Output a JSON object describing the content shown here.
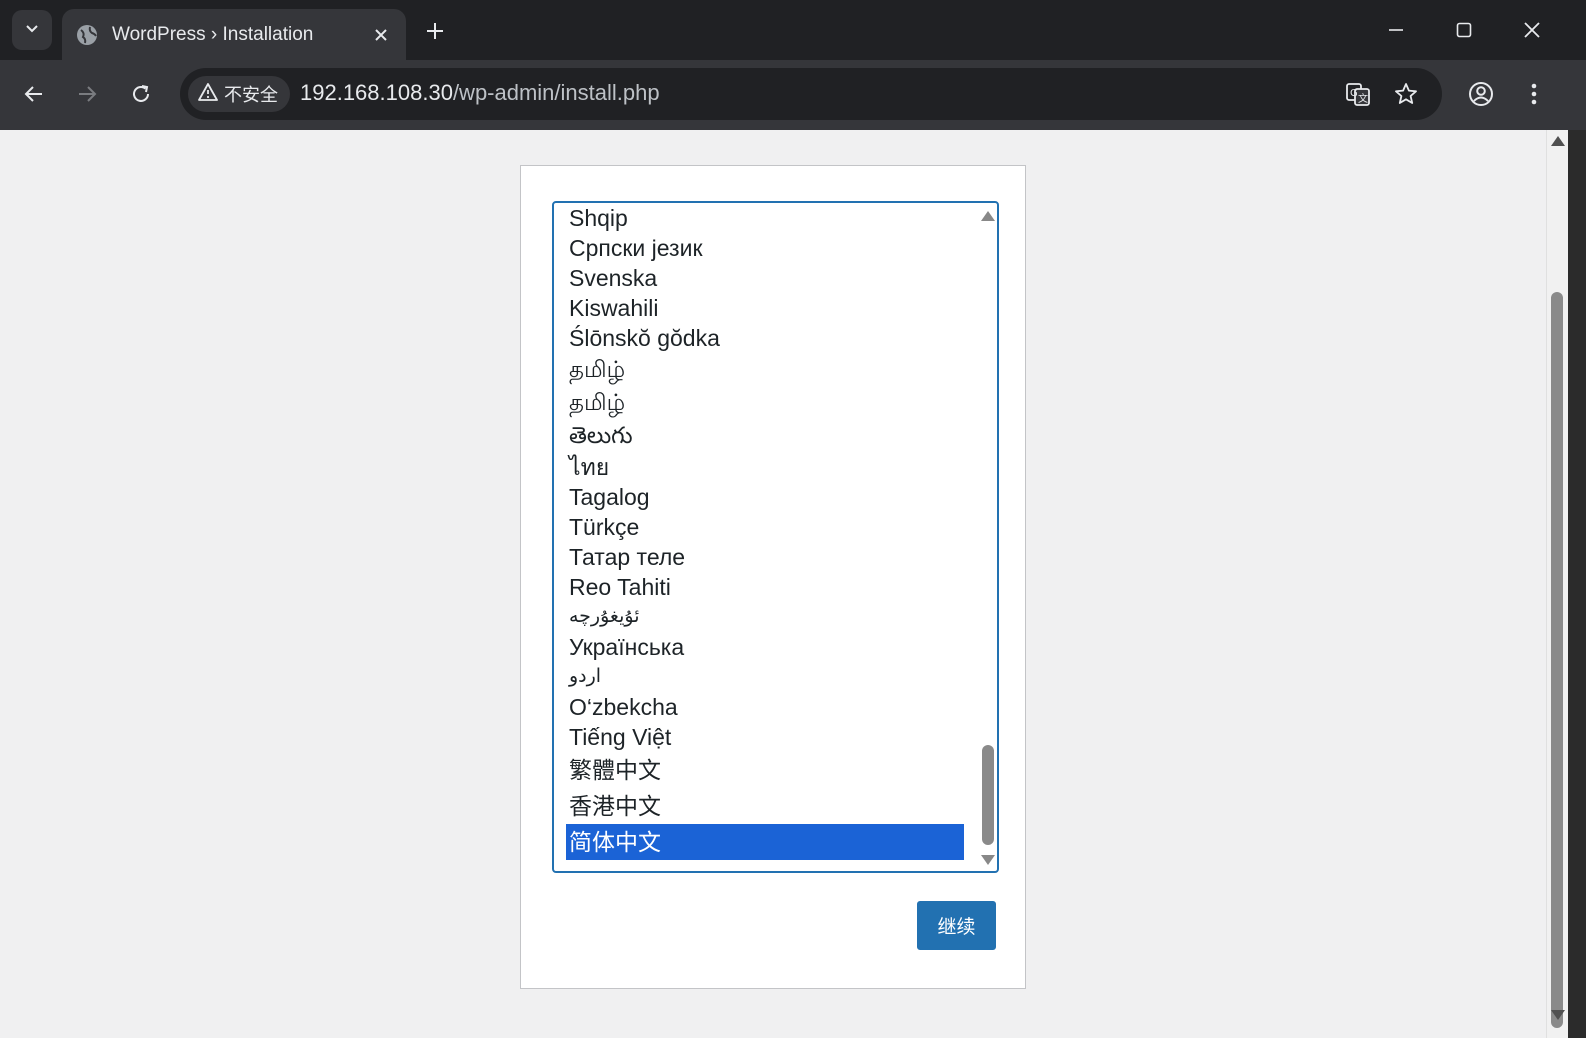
{
  "browser": {
    "tab": {
      "title": "WordPress › Installation"
    },
    "omnibox": {
      "security_label": "不安全",
      "url_host": "192.168.108.30",
      "url_path": "/wp-admin/install.php"
    }
  },
  "page": {
    "languages": [
      "Shqip",
      "Српски језик",
      "Svenska",
      "Kiswahili",
      "Ślōnskŏ gŏdka",
      "தமிழ்",
      "தமிழ்",
      "తెలుగు",
      "ไทย",
      "Tagalog",
      "Türkçe",
      "Татар теле",
      "Reo Tahiti",
      "ئۇيغۇرچە",
      "Українська",
      "اردو",
      "O‘zbekcha",
      "Tiếng Việt",
      "繁體中文",
      "香港中文",
      "简体中文"
    ],
    "selected_language": "简体中文",
    "continue_label": "继续"
  },
  "colors": {
    "accent": "#2271b1",
    "selection": "#1b63d6",
    "page_background": "#f0f0f1"
  }
}
